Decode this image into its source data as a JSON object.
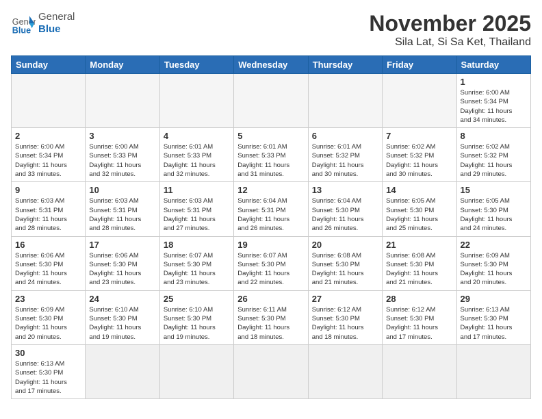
{
  "header": {
    "logo_general": "General",
    "logo_blue": "Blue",
    "month_title": "November 2025",
    "location": "Sila Lat, Si Sa Ket, Thailand"
  },
  "weekdays": [
    "Sunday",
    "Monday",
    "Tuesday",
    "Wednesday",
    "Thursday",
    "Friday",
    "Saturday"
  ],
  "days": [
    {
      "num": "",
      "info": ""
    },
    {
      "num": "",
      "info": ""
    },
    {
      "num": "",
      "info": ""
    },
    {
      "num": "",
      "info": ""
    },
    {
      "num": "",
      "info": ""
    },
    {
      "num": "",
      "info": ""
    },
    {
      "num": "1",
      "info": "Sunrise: 6:00 AM\nSunset: 5:34 PM\nDaylight: 11 hours\nand 34 minutes."
    },
    {
      "num": "2",
      "info": "Sunrise: 6:00 AM\nSunset: 5:34 PM\nDaylight: 11 hours\nand 33 minutes."
    },
    {
      "num": "3",
      "info": "Sunrise: 6:00 AM\nSunset: 5:33 PM\nDaylight: 11 hours\nand 32 minutes."
    },
    {
      "num": "4",
      "info": "Sunrise: 6:01 AM\nSunset: 5:33 PM\nDaylight: 11 hours\nand 32 minutes."
    },
    {
      "num": "5",
      "info": "Sunrise: 6:01 AM\nSunset: 5:33 PM\nDaylight: 11 hours\nand 31 minutes."
    },
    {
      "num": "6",
      "info": "Sunrise: 6:01 AM\nSunset: 5:32 PM\nDaylight: 11 hours\nand 30 minutes."
    },
    {
      "num": "7",
      "info": "Sunrise: 6:02 AM\nSunset: 5:32 PM\nDaylight: 11 hours\nand 30 minutes."
    },
    {
      "num": "8",
      "info": "Sunrise: 6:02 AM\nSunset: 5:32 PM\nDaylight: 11 hours\nand 29 minutes."
    },
    {
      "num": "9",
      "info": "Sunrise: 6:03 AM\nSunset: 5:31 PM\nDaylight: 11 hours\nand 28 minutes."
    },
    {
      "num": "10",
      "info": "Sunrise: 6:03 AM\nSunset: 5:31 PM\nDaylight: 11 hours\nand 28 minutes."
    },
    {
      "num": "11",
      "info": "Sunrise: 6:03 AM\nSunset: 5:31 PM\nDaylight: 11 hours\nand 27 minutes."
    },
    {
      "num": "12",
      "info": "Sunrise: 6:04 AM\nSunset: 5:31 PM\nDaylight: 11 hours\nand 26 minutes."
    },
    {
      "num": "13",
      "info": "Sunrise: 6:04 AM\nSunset: 5:30 PM\nDaylight: 11 hours\nand 26 minutes."
    },
    {
      "num": "14",
      "info": "Sunrise: 6:05 AM\nSunset: 5:30 PM\nDaylight: 11 hours\nand 25 minutes."
    },
    {
      "num": "15",
      "info": "Sunrise: 6:05 AM\nSunset: 5:30 PM\nDaylight: 11 hours\nand 24 minutes."
    },
    {
      "num": "16",
      "info": "Sunrise: 6:06 AM\nSunset: 5:30 PM\nDaylight: 11 hours\nand 24 minutes."
    },
    {
      "num": "17",
      "info": "Sunrise: 6:06 AM\nSunset: 5:30 PM\nDaylight: 11 hours\nand 23 minutes."
    },
    {
      "num": "18",
      "info": "Sunrise: 6:07 AM\nSunset: 5:30 PM\nDaylight: 11 hours\nand 23 minutes."
    },
    {
      "num": "19",
      "info": "Sunrise: 6:07 AM\nSunset: 5:30 PM\nDaylight: 11 hours\nand 22 minutes."
    },
    {
      "num": "20",
      "info": "Sunrise: 6:08 AM\nSunset: 5:30 PM\nDaylight: 11 hours\nand 21 minutes."
    },
    {
      "num": "21",
      "info": "Sunrise: 6:08 AM\nSunset: 5:30 PM\nDaylight: 11 hours\nand 21 minutes."
    },
    {
      "num": "22",
      "info": "Sunrise: 6:09 AM\nSunset: 5:30 PM\nDaylight: 11 hours\nand 20 minutes."
    },
    {
      "num": "23",
      "info": "Sunrise: 6:09 AM\nSunset: 5:30 PM\nDaylight: 11 hours\nand 20 minutes."
    },
    {
      "num": "24",
      "info": "Sunrise: 6:10 AM\nSunset: 5:30 PM\nDaylight: 11 hours\nand 19 minutes."
    },
    {
      "num": "25",
      "info": "Sunrise: 6:10 AM\nSunset: 5:30 PM\nDaylight: 11 hours\nand 19 minutes."
    },
    {
      "num": "26",
      "info": "Sunrise: 6:11 AM\nSunset: 5:30 PM\nDaylight: 11 hours\nand 18 minutes."
    },
    {
      "num": "27",
      "info": "Sunrise: 6:12 AM\nSunset: 5:30 PM\nDaylight: 11 hours\nand 18 minutes."
    },
    {
      "num": "28",
      "info": "Sunrise: 6:12 AM\nSunset: 5:30 PM\nDaylight: 11 hours\nand 17 minutes."
    },
    {
      "num": "29",
      "info": "Sunrise: 6:13 AM\nSunset: 5:30 PM\nDaylight: 11 hours\nand 17 minutes."
    },
    {
      "num": "30",
      "info": "Sunrise: 6:13 AM\nSunset: 5:30 PM\nDaylight: 11 hours\nand 17 minutes."
    },
    {
      "num": "",
      "info": ""
    },
    {
      "num": "",
      "info": ""
    },
    {
      "num": "",
      "info": ""
    },
    {
      "num": "",
      "info": ""
    },
    {
      "num": "",
      "info": ""
    },
    {
      "num": "",
      "info": ""
    }
  ]
}
